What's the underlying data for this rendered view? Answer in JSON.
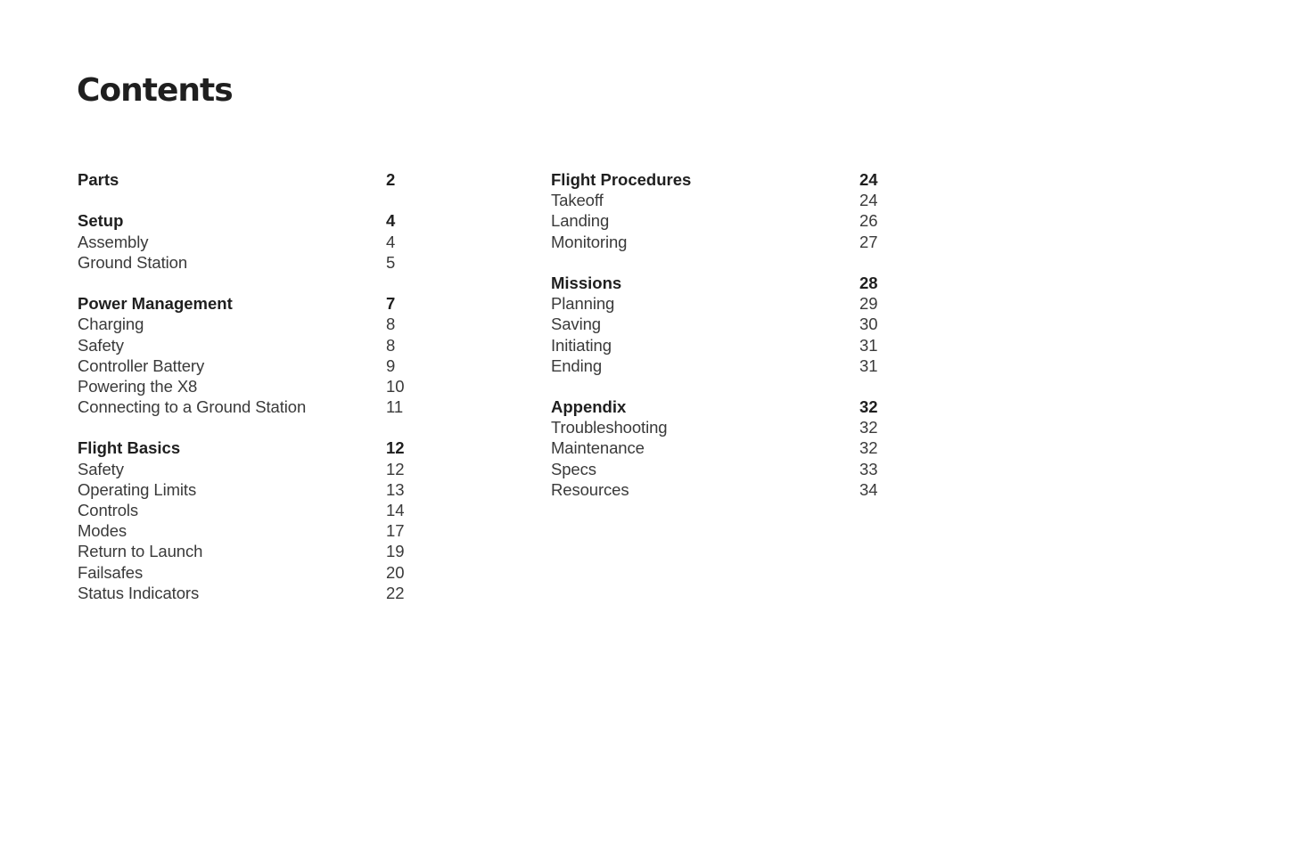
{
  "title": "Contents",
  "columns": [
    {
      "sections": [
        {
          "heading": {
            "label": "Parts",
            "page": "2"
          },
          "entries": []
        },
        {
          "heading": {
            "label": "Setup",
            "page": "4"
          },
          "entries": [
            {
              "label": "Assembly",
              "page": "4"
            },
            {
              "label": "Ground Station",
              "page": "5"
            }
          ]
        },
        {
          "heading": {
            "label": "Power Management",
            "page": "7"
          },
          "entries": [
            {
              "label": "Charging",
              "page": "8"
            },
            {
              "label": "Safety",
              "page": "8"
            },
            {
              "label": "Controller Battery",
              "page": "9"
            },
            {
              "label": "Powering the X8",
              "page": "10"
            },
            {
              "label": "Connecting to a Ground Station",
              "page": "11"
            }
          ]
        },
        {
          "heading": {
            "label": "Flight Basics",
            "page": "12"
          },
          "entries": [
            {
              "label": "Safety",
              "page": "12"
            },
            {
              "label": "Operating Limits",
              "page": "13"
            },
            {
              "label": "Controls",
              "page": "14"
            },
            {
              "label": "Modes",
              "page": "17"
            },
            {
              "label": "Return to Launch",
              "page": "19"
            },
            {
              "label": "Failsafes",
              "page": "20"
            },
            {
              "label": "Status Indicators",
              "page": "22"
            }
          ]
        }
      ]
    },
    {
      "sections": [
        {
          "heading": {
            "label": "Flight Procedures",
            "page": "24"
          },
          "entries": [
            {
              "label": "Takeoff",
              "page": "24"
            },
            {
              "label": "Landing",
              "page": "26"
            },
            {
              "label": "Monitoring",
              "page": "27"
            }
          ]
        },
        {
          "heading": {
            "label": "Missions",
            "page": "28"
          },
          "entries": [
            {
              "label": "Planning",
              "page": "29"
            },
            {
              "label": "Saving",
              "page": "30"
            },
            {
              "label": "Initiating",
              "page": "31"
            },
            {
              "label": "Ending",
              "page": "31"
            }
          ]
        },
        {
          "heading": {
            "label": "Appendix",
            "page": "32"
          },
          "entries": [
            {
              "label": "Troubleshooting",
              "page": "32"
            },
            {
              "label": "Maintenance",
              "page": "32"
            },
            {
              "label": "Specs",
              "page": "33"
            },
            {
              "label": "Resources",
              "page": "34"
            }
          ]
        }
      ]
    }
  ]
}
